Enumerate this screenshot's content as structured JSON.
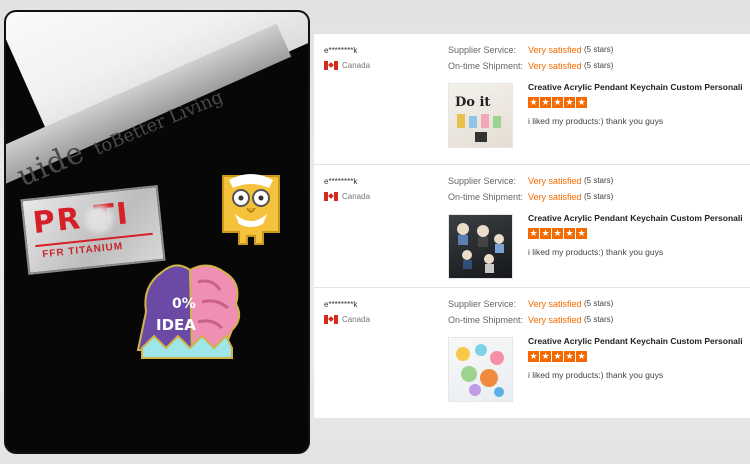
{
  "photo": {
    "book_text_big": "uide",
    "book_text_small": "toBetter Living",
    "badge_word": "PR  TI",
    "badge_sub": "FFR TITANIUM",
    "pin_text_top": "0%",
    "pin_text_bottom": "IDEA"
  },
  "colors": {
    "accent": "#f56a00",
    "badge_red": "#d61f26",
    "pin_purple": "#6b4aa6",
    "pin_pink": "#f08fb4",
    "pin_yellow": "#f5c33b"
  },
  "reviews": [
    {
      "user": "e********k",
      "country": "Canada",
      "flag_icon": "canada-flag-icon",
      "supplier_label": "Supplier Service:",
      "supplier_value": "Very satisfied",
      "supplier_stars": "(5 stars)",
      "shipment_label": "On-time Shipment:",
      "shipment_value": "Very satisfied",
      "shipment_stars": "(5 stars)",
      "product_title": "Creative Acrylic Pendant Keychain Custom Personaliz...",
      "rating": 5,
      "comment": "i liked my products:) thank you guys",
      "thumb_text": "Do it"
    },
    {
      "user": "e********k",
      "country": "Canada",
      "flag_icon": "canada-flag-icon",
      "supplier_label": "Supplier Service:",
      "supplier_value": "Very satisfied",
      "supplier_stars": "(5 stars)",
      "shipment_label": "On-time Shipment:",
      "shipment_value": "Very satisfied",
      "shipment_stars": "(5 stars)",
      "product_title": "Creative Acrylic Pendant Keychain Custom Personaliz...",
      "rating": 5,
      "comment": "i liked my products:) thank you guys"
    },
    {
      "user": "e********k",
      "country": "Canada",
      "flag_icon": "canada-flag-icon",
      "supplier_label": "Supplier Service:",
      "supplier_value": "Very satisfied",
      "supplier_stars": "(5 stars)",
      "shipment_label": "On-time Shipment:",
      "shipment_value": "Very satisfied",
      "shipment_stars": "(5 stars)",
      "product_title": "Creative Acrylic Pendant Keychain Custom Personaliz...",
      "rating": 5,
      "comment": "i liked my products:) thank you guys"
    }
  ]
}
